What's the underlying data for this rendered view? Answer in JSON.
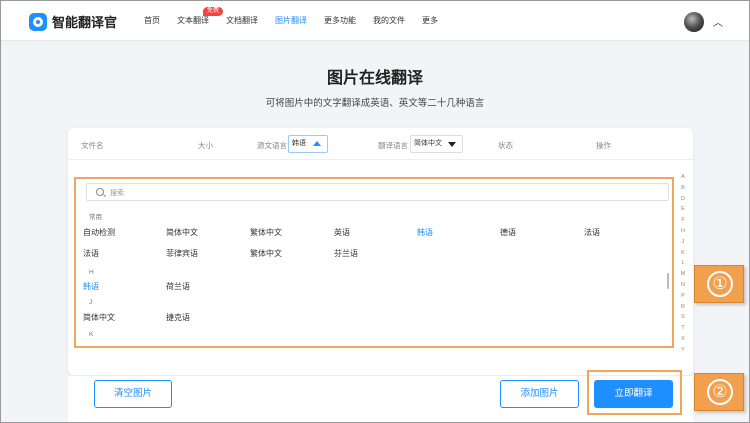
{
  "header": {
    "app_name": "智能翻译官",
    "nav": [
      {
        "label": "首页",
        "active": false
      },
      {
        "label": "文本翻译",
        "active": false,
        "badge": "免费"
      },
      {
        "label": "文档翻译",
        "active": false
      },
      {
        "label": "图片翻译",
        "active": true
      },
      {
        "label": "更多功能",
        "active": false
      },
      {
        "label": "我的文件",
        "active": false
      },
      {
        "label": "更多",
        "active": false
      }
    ]
  },
  "page": {
    "title": "图片在线翻译",
    "subtitle": "可将图片中的文字翻译成英语、英文等二十几种语言"
  },
  "table": {
    "headers": {
      "filename": "文件名",
      "size": "大小",
      "source_lang": "源文语言",
      "target_lang": "翻译语言",
      "status": "状态",
      "action": "操作"
    },
    "source_lang_value": "韩语",
    "target_lang_value": "简体中文"
  },
  "dropdown": {
    "search_placeholder": "搜索",
    "groups": [
      {
        "label": "常用",
        "rows": [
          [
            "自动检测",
            "简体中文",
            "繁体中文",
            "英语",
            "韩语",
            "德语",
            "法语"
          ],
          [
            "法语",
            "菲律宾语",
            "繁体中文",
            "芬兰语"
          ]
        ]
      },
      {
        "label": "H",
        "rows": [
          [
            "韩语",
            "荷兰语"
          ]
        ]
      },
      {
        "label": "J",
        "rows": [
          [
            "简体中文",
            "捷克语"
          ]
        ]
      },
      {
        "label": "K",
        "rows": []
      }
    ],
    "selected": "韩语",
    "alphabet": [
      "A",
      "B",
      "D",
      "E",
      "F",
      "H",
      "J",
      "K",
      "L",
      "M",
      "N",
      "P",
      "R",
      "S",
      "T",
      "X",
      "Y"
    ]
  },
  "buttons": {
    "clear": "清空图片",
    "add": "添加图片",
    "translate": "立即翻译"
  },
  "callouts": [
    "①",
    "②"
  ],
  "colors": {
    "accent": "#1e8fff",
    "highlight": "#f2a65a",
    "badge": "#f04545"
  }
}
